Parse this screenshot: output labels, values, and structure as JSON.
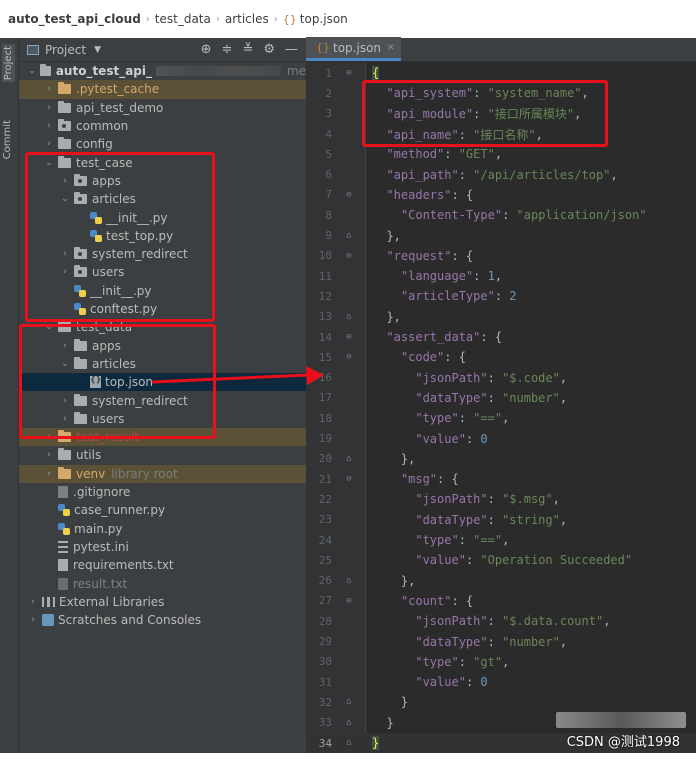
{
  "breadcrumb": [
    "auto_test_api_cloud",
    "test_data",
    "articles",
    "top.json"
  ],
  "tool_strip": {
    "project": "Project",
    "commit": "Commit"
  },
  "panel": {
    "title": "Project"
  },
  "tree": [
    {
      "label": "auto_test_api_",
      "level": 0,
      "arrow": "down",
      "icon": "folder",
      "bold": true,
      "blurred": true,
      "hint": "me"
    },
    {
      "label": ".pytest_cache",
      "level": 1,
      "arrow": "right",
      "icon": "folder-orange",
      "color": "orange",
      "row": "excluded"
    },
    {
      "label": "api_test_demo",
      "level": 1,
      "arrow": "right",
      "icon": "folder"
    },
    {
      "label": "common",
      "level": 1,
      "arrow": "right",
      "icon": "folder-pkg"
    },
    {
      "label": "config",
      "level": 1,
      "arrow": "right",
      "icon": "folder"
    },
    {
      "label": "test_case",
      "level": 1,
      "arrow": "down",
      "icon": "folder"
    },
    {
      "label": "apps",
      "level": 2,
      "arrow": "right",
      "icon": "folder-pkg"
    },
    {
      "label": "articles",
      "level": 2,
      "arrow": "down",
      "icon": "folder-pkg"
    },
    {
      "label": "__init__.py",
      "level": 3,
      "arrow": "",
      "icon": "py"
    },
    {
      "label": "test_top.py",
      "level": 3,
      "arrow": "",
      "icon": "py"
    },
    {
      "label": "system_redirect",
      "level": 2,
      "arrow": "right",
      "icon": "folder-pkg"
    },
    {
      "label": "users",
      "level": 2,
      "arrow": "right",
      "icon": "folder-pkg"
    },
    {
      "label": "__init__.py",
      "level": 2,
      "arrow": "",
      "icon": "py"
    },
    {
      "label": "conftest.py",
      "level": 2,
      "arrow": "",
      "icon": "py"
    },
    {
      "label": "test_data",
      "level": 1,
      "arrow": "down",
      "icon": "folder"
    },
    {
      "label": "apps",
      "level": 2,
      "arrow": "right",
      "icon": "folder"
    },
    {
      "label": "articles",
      "level": 2,
      "arrow": "down",
      "icon": "folder"
    },
    {
      "label": "top.json",
      "level": 3,
      "arrow": "",
      "icon": "json",
      "row": "selected"
    },
    {
      "label": "system_redirect",
      "level": 2,
      "arrow": "right",
      "icon": "folder"
    },
    {
      "label": "users",
      "level": 2,
      "arrow": "right",
      "icon": "folder"
    },
    {
      "label": "test_result",
      "level": 1,
      "arrow": "right",
      "icon": "folder-orange",
      "color": "red",
      "row": "excluded"
    },
    {
      "label": "utils",
      "level": 1,
      "arrow": "right",
      "icon": "folder"
    },
    {
      "label": "venv",
      "level": 1,
      "arrow": "right",
      "icon": "folder-orange",
      "color": "orange",
      "row": "excluded",
      "hint": "library root"
    },
    {
      "label": ".gitignore",
      "level": 1,
      "arrow": "",
      "icon": "git"
    },
    {
      "label": "case_runner.py",
      "level": 1,
      "arrow": "",
      "icon": "py"
    },
    {
      "label": "main.py",
      "level": 1,
      "arrow": "",
      "icon": "py"
    },
    {
      "label": "pytest.ini",
      "level": 1,
      "arrow": "",
      "icon": "ini"
    },
    {
      "label": "requirements.txt",
      "level": 1,
      "arrow": "",
      "icon": "txt"
    },
    {
      "label": "result.txt",
      "level": 1,
      "arrow": "",
      "icon": "txt-dim",
      "color": "dim"
    },
    {
      "label": "External Libraries",
      "level": 0,
      "arrow": "right",
      "icon": "libs"
    },
    {
      "label": "Scratches and Consoles",
      "level": 0,
      "arrow": "right",
      "icon": "scratch"
    }
  ],
  "editor": {
    "tab": "top.json",
    "current_line": 34,
    "lines": [
      [
        [
          "{",
          "brace-hl"
        ]
      ],
      [
        [
          "  ",
          "p"
        ],
        [
          "\"api_system\"",
          "k"
        ],
        [
          ": ",
          "p"
        ],
        [
          "\"system_name\"",
          "s"
        ],
        [
          ",",
          "p"
        ]
      ],
      [
        [
          "  ",
          "p"
        ],
        [
          "\"api_module\"",
          "k"
        ],
        [
          ": ",
          "p"
        ],
        [
          "\"接口所属模块\"",
          "s"
        ],
        [
          ",",
          "p"
        ]
      ],
      [
        [
          "  ",
          "p"
        ],
        [
          "\"api_name\"",
          "k"
        ],
        [
          ": ",
          "p"
        ],
        [
          "\"接口名称\"",
          "s"
        ],
        [
          ",",
          "p"
        ]
      ],
      [
        [
          "  ",
          "p"
        ],
        [
          "\"method\"",
          "k"
        ],
        [
          ": ",
          "p"
        ],
        [
          "\"GET\"",
          "s"
        ],
        [
          ",",
          "p"
        ]
      ],
      [
        [
          "  ",
          "p"
        ],
        [
          "\"api_path\"",
          "k"
        ],
        [
          ": ",
          "p"
        ],
        [
          "\"/api/articles/top\"",
          "s"
        ],
        [
          ",",
          "p"
        ]
      ],
      [
        [
          "  ",
          "p"
        ],
        [
          "\"headers\"",
          "k"
        ],
        [
          ": {",
          "p"
        ]
      ],
      [
        [
          "    ",
          "p"
        ],
        [
          "\"Content-Type\"",
          "k"
        ],
        [
          ": ",
          "p"
        ],
        [
          "\"application/json\"",
          "s"
        ]
      ],
      [
        [
          "  },",
          "p"
        ]
      ],
      [
        [
          "  ",
          "p"
        ],
        [
          "\"request\"",
          "k"
        ],
        [
          ": {",
          "p"
        ]
      ],
      [
        [
          "    ",
          "p"
        ],
        [
          "\"language\"",
          "k"
        ],
        [
          ": ",
          "p"
        ],
        [
          "1",
          "n"
        ],
        [
          ",",
          "p"
        ]
      ],
      [
        [
          "    ",
          "p"
        ],
        [
          "\"articleType\"",
          "k"
        ],
        [
          ": ",
          "p"
        ],
        [
          "2",
          "n"
        ]
      ],
      [
        [
          "  },",
          "p"
        ]
      ],
      [
        [
          "  ",
          "p"
        ],
        [
          "\"assert_data\"",
          "k"
        ],
        [
          ": {",
          "p"
        ]
      ],
      [
        [
          "    ",
          "p"
        ],
        [
          "\"code\"",
          "k"
        ],
        [
          ": {",
          "p"
        ]
      ],
      [
        [
          "      ",
          "p"
        ],
        [
          "\"jsonPath\"",
          "k"
        ],
        [
          ": ",
          "p"
        ],
        [
          "\"$.code\"",
          "s"
        ],
        [
          ",",
          "p"
        ]
      ],
      [
        [
          "      ",
          "p"
        ],
        [
          "\"dataType\"",
          "k"
        ],
        [
          ": ",
          "p"
        ],
        [
          "\"number\"",
          "s"
        ],
        [
          ",",
          "p"
        ]
      ],
      [
        [
          "      ",
          "p"
        ],
        [
          "\"type\"",
          "k"
        ],
        [
          ": ",
          "p"
        ],
        [
          "\"==\"",
          "s"
        ],
        [
          ",",
          "p"
        ]
      ],
      [
        [
          "      ",
          "p"
        ],
        [
          "\"value\"",
          "k"
        ],
        [
          ": ",
          "p"
        ],
        [
          "0",
          "n"
        ]
      ],
      [
        [
          "    },",
          "p"
        ]
      ],
      [
        [
          "    ",
          "p"
        ],
        [
          "\"msg\"",
          "k"
        ],
        [
          ": {",
          "p"
        ]
      ],
      [
        [
          "      ",
          "p"
        ],
        [
          "\"jsonPath\"",
          "k"
        ],
        [
          ": ",
          "p"
        ],
        [
          "\"$.msg\"",
          "s"
        ],
        [
          ",",
          "p"
        ]
      ],
      [
        [
          "      ",
          "p"
        ],
        [
          "\"dataType\"",
          "k"
        ],
        [
          ": ",
          "p"
        ],
        [
          "\"string\"",
          "s"
        ],
        [
          ",",
          "p"
        ]
      ],
      [
        [
          "      ",
          "p"
        ],
        [
          "\"type\"",
          "k"
        ],
        [
          ": ",
          "p"
        ],
        [
          "\"==\"",
          "s"
        ],
        [
          ",",
          "p"
        ]
      ],
      [
        [
          "      ",
          "p"
        ],
        [
          "\"value\"",
          "k"
        ],
        [
          ": ",
          "p"
        ],
        [
          "\"Operation Succeeded\"",
          "s"
        ]
      ],
      [
        [
          "    },",
          "p"
        ]
      ],
      [
        [
          "    ",
          "p"
        ],
        [
          "\"count\"",
          "k"
        ],
        [
          ": {",
          "p"
        ]
      ],
      [
        [
          "      ",
          "p"
        ],
        [
          "\"jsonPath\"",
          "k"
        ],
        [
          ": ",
          "p"
        ],
        [
          "\"$.data.count\"",
          "s"
        ],
        [
          ",",
          "p"
        ]
      ],
      [
        [
          "      ",
          "p"
        ],
        [
          "\"dataType\"",
          "k"
        ],
        [
          ": ",
          "p"
        ],
        [
          "\"number\"",
          "s"
        ],
        [
          ",",
          "p"
        ]
      ],
      [
        [
          "      ",
          "p"
        ],
        [
          "\"type\"",
          "k"
        ],
        [
          ": ",
          "p"
        ],
        [
          "\"gt\"",
          "s"
        ],
        [
          ",",
          "p"
        ]
      ],
      [
        [
          "      ",
          "p"
        ],
        [
          "\"value\"",
          "k"
        ],
        [
          ": ",
          "p"
        ],
        [
          "0",
          "n"
        ]
      ],
      [
        [
          "    }",
          "p"
        ]
      ],
      [
        [
          "  }",
          "p"
        ]
      ],
      [
        [
          "}",
          "brace-hl"
        ]
      ]
    ]
  },
  "watermark": "CSDN @测试1998",
  "colors": {
    "annotation": "#e8101a",
    "selection": "#0d293e",
    "tab_underline": "#4a88c7"
  }
}
